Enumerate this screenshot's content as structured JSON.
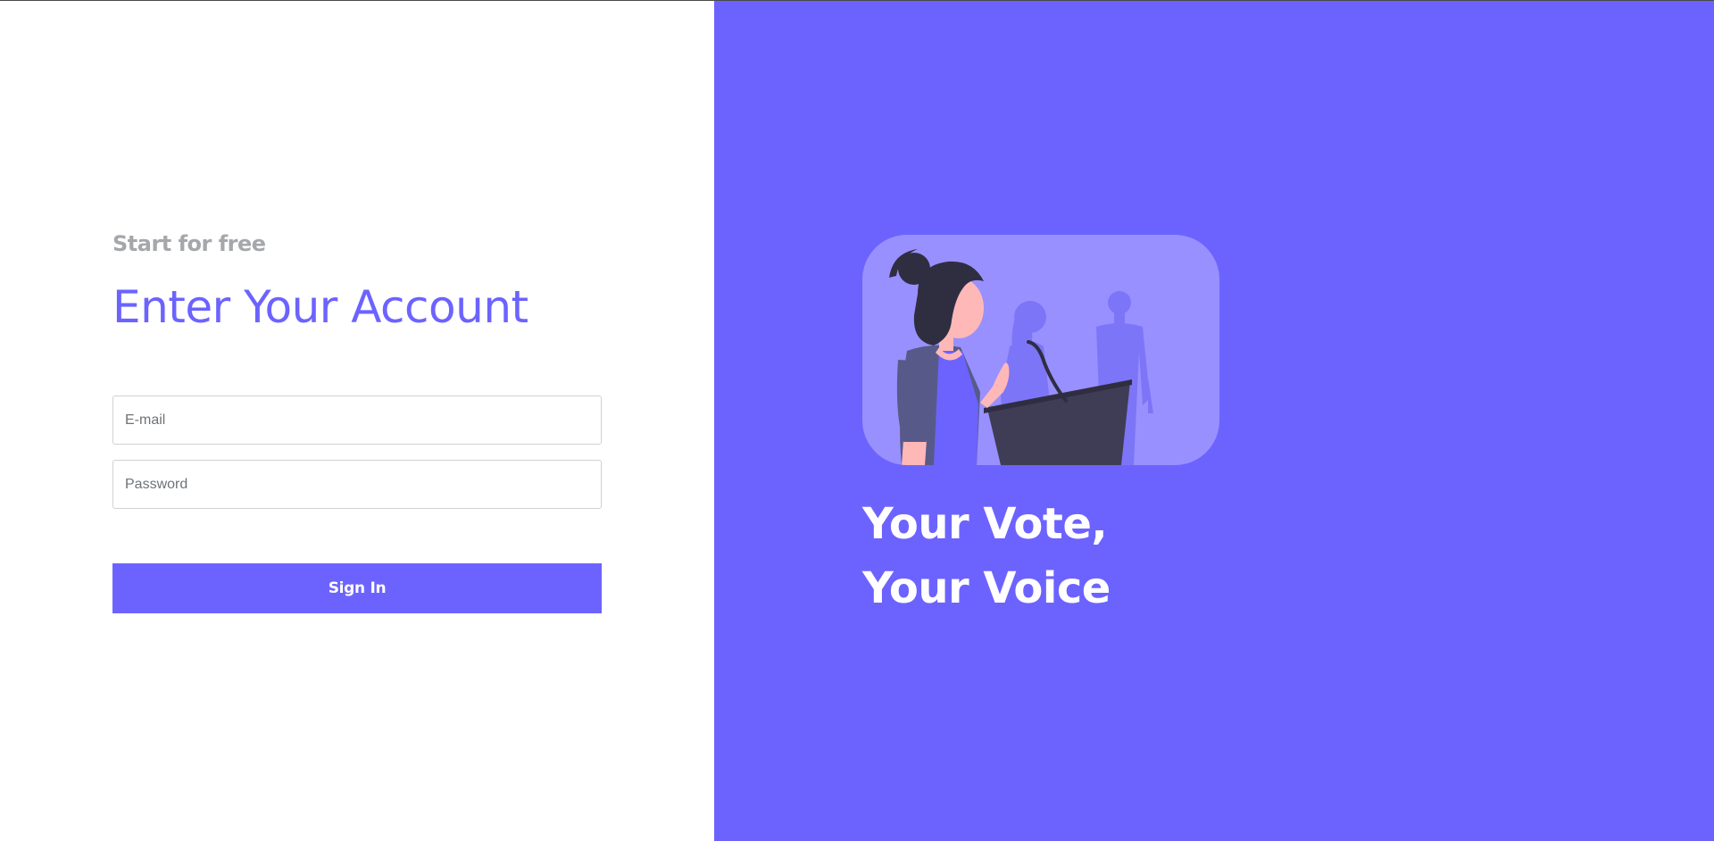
{
  "login": {
    "subtitle": "Start for free",
    "title": "Enter Your Account",
    "email_placeholder": "E-mail",
    "password_placeholder": "Password",
    "signin_label": "Sign In"
  },
  "hero": {
    "tagline_line1": "Your Vote,",
    "tagline_line2": "Your Voice",
    "illustration": "woman-at-podium-illustration"
  },
  "colors": {
    "accent": "#6c63ff",
    "illustration_bg": "#9890ff",
    "subtitle": "#a5a7ab"
  }
}
